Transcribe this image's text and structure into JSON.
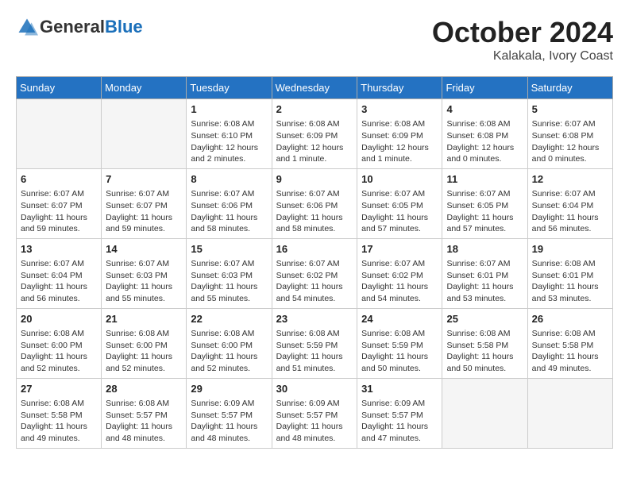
{
  "header": {
    "logo_general": "General",
    "logo_blue": "Blue",
    "month": "October 2024",
    "location": "Kalakala, Ivory Coast"
  },
  "weekdays": [
    "Sunday",
    "Monday",
    "Tuesday",
    "Wednesday",
    "Thursday",
    "Friday",
    "Saturday"
  ],
  "weeks": [
    [
      {
        "day": "",
        "info": ""
      },
      {
        "day": "",
        "info": ""
      },
      {
        "day": "1",
        "info": "Sunrise: 6:08 AM\nSunset: 6:10 PM\nDaylight: 12 hours\nand 2 minutes."
      },
      {
        "day": "2",
        "info": "Sunrise: 6:08 AM\nSunset: 6:09 PM\nDaylight: 12 hours\nand 1 minute."
      },
      {
        "day": "3",
        "info": "Sunrise: 6:08 AM\nSunset: 6:09 PM\nDaylight: 12 hours\nand 1 minute."
      },
      {
        "day": "4",
        "info": "Sunrise: 6:08 AM\nSunset: 6:08 PM\nDaylight: 12 hours\nand 0 minutes."
      },
      {
        "day": "5",
        "info": "Sunrise: 6:07 AM\nSunset: 6:08 PM\nDaylight: 12 hours\nand 0 minutes."
      }
    ],
    [
      {
        "day": "6",
        "info": "Sunrise: 6:07 AM\nSunset: 6:07 PM\nDaylight: 11 hours\nand 59 minutes."
      },
      {
        "day": "7",
        "info": "Sunrise: 6:07 AM\nSunset: 6:07 PM\nDaylight: 11 hours\nand 59 minutes."
      },
      {
        "day": "8",
        "info": "Sunrise: 6:07 AM\nSunset: 6:06 PM\nDaylight: 11 hours\nand 58 minutes."
      },
      {
        "day": "9",
        "info": "Sunrise: 6:07 AM\nSunset: 6:06 PM\nDaylight: 11 hours\nand 58 minutes."
      },
      {
        "day": "10",
        "info": "Sunrise: 6:07 AM\nSunset: 6:05 PM\nDaylight: 11 hours\nand 57 minutes."
      },
      {
        "day": "11",
        "info": "Sunrise: 6:07 AM\nSunset: 6:05 PM\nDaylight: 11 hours\nand 57 minutes."
      },
      {
        "day": "12",
        "info": "Sunrise: 6:07 AM\nSunset: 6:04 PM\nDaylight: 11 hours\nand 56 minutes."
      }
    ],
    [
      {
        "day": "13",
        "info": "Sunrise: 6:07 AM\nSunset: 6:04 PM\nDaylight: 11 hours\nand 56 minutes."
      },
      {
        "day": "14",
        "info": "Sunrise: 6:07 AM\nSunset: 6:03 PM\nDaylight: 11 hours\nand 55 minutes."
      },
      {
        "day": "15",
        "info": "Sunrise: 6:07 AM\nSunset: 6:03 PM\nDaylight: 11 hours\nand 55 minutes."
      },
      {
        "day": "16",
        "info": "Sunrise: 6:07 AM\nSunset: 6:02 PM\nDaylight: 11 hours\nand 54 minutes."
      },
      {
        "day": "17",
        "info": "Sunrise: 6:07 AM\nSunset: 6:02 PM\nDaylight: 11 hours\nand 54 minutes."
      },
      {
        "day": "18",
        "info": "Sunrise: 6:07 AM\nSunset: 6:01 PM\nDaylight: 11 hours\nand 53 minutes."
      },
      {
        "day": "19",
        "info": "Sunrise: 6:08 AM\nSunset: 6:01 PM\nDaylight: 11 hours\nand 53 minutes."
      }
    ],
    [
      {
        "day": "20",
        "info": "Sunrise: 6:08 AM\nSunset: 6:00 PM\nDaylight: 11 hours\nand 52 minutes."
      },
      {
        "day": "21",
        "info": "Sunrise: 6:08 AM\nSunset: 6:00 PM\nDaylight: 11 hours\nand 52 minutes."
      },
      {
        "day": "22",
        "info": "Sunrise: 6:08 AM\nSunset: 6:00 PM\nDaylight: 11 hours\nand 52 minutes."
      },
      {
        "day": "23",
        "info": "Sunrise: 6:08 AM\nSunset: 5:59 PM\nDaylight: 11 hours\nand 51 minutes."
      },
      {
        "day": "24",
        "info": "Sunrise: 6:08 AM\nSunset: 5:59 PM\nDaylight: 11 hours\nand 50 minutes."
      },
      {
        "day": "25",
        "info": "Sunrise: 6:08 AM\nSunset: 5:58 PM\nDaylight: 11 hours\nand 50 minutes."
      },
      {
        "day": "26",
        "info": "Sunrise: 6:08 AM\nSunset: 5:58 PM\nDaylight: 11 hours\nand 49 minutes."
      }
    ],
    [
      {
        "day": "27",
        "info": "Sunrise: 6:08 AM\nSunset: 5:58 PM\nDaylight: 11 hours\nand 49 minutes."
      },
      {
        "day": "28",
        "info": "Sunrise: 6:08 AM\nSunset: 5:57 PM\nDaylight: 11 hours\nand 48 minutes."
      },
      {
        "day": "29",
        "info": "Sunrise: 6:09 AM\nSunset: 5:57 PM\nDaylight: 11 hours\nand 48 minutes."
      },
      {
        "day": "30",
        "info": "Sunrise: 6:09 AM\nSunset: 5:57 PM\nDaylight: 11 hours\nand 48 minutes."
      },
      {
        "day": "31",
        "info": "Sunrise: 6:09 AM\nSunset: 5:57 PM\nDaylight: 11 hours\nand 47 minutes."
      },
      {
        "day": "",
        "info": ""
      },
      {
        "day": "",
        "info": ""
      }
    ]
  ]
}
